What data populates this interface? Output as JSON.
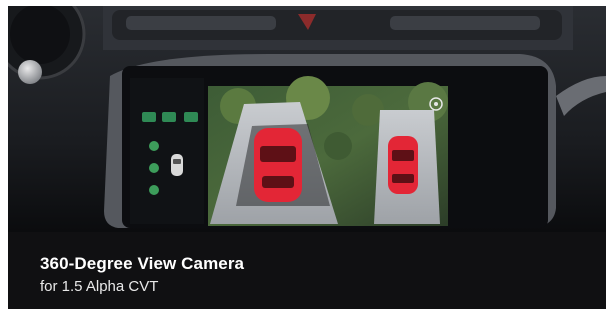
{
  "card": {
    "title": "360-Degree View Camera",
    "subtitle": "for 1.5 Alpha CVT"
  },
  "screen": {
    "display_mode": "360-degree camera view",
    "accent_color": "#e32636",
    "road_color": "#b9bcc0",
    "ui_green": "#2f8a55",
    "icons": [
      "car-top-view-icon",
      "settings-icon"
    ]
  }
}
